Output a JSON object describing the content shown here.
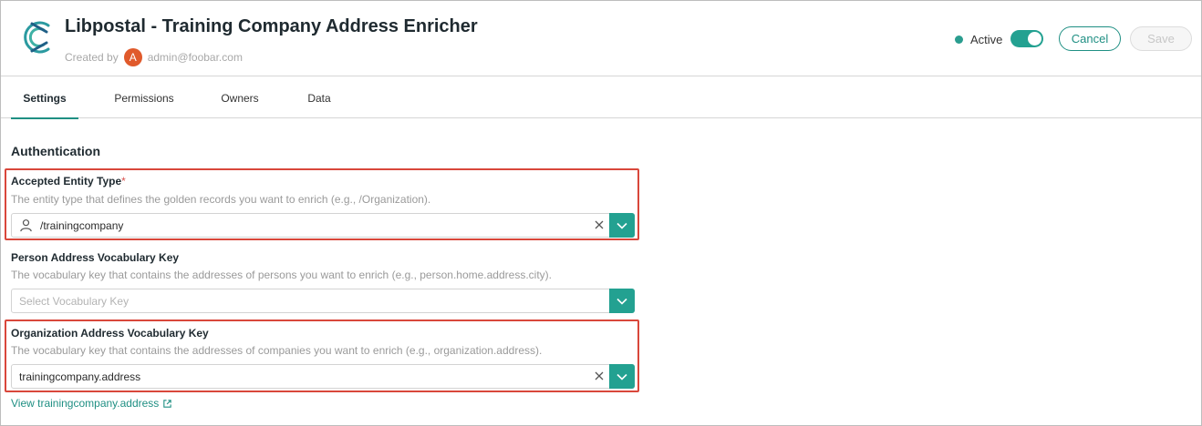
{
  "header": {
    "title": "Libpostal - Training Company Address Enricher",
    "created_by_label": "Created by",
    "avatar_initial": "A",
    "creator": "admin@foobar.com",
    "status_label": "Active",
    "toggle_on": true,
    "cancel_label": "Cancel",
    "save_label": "Save"
  },
  "tabs": [
    {
      "label": "Settings",
      "active": true
    },
    {
      "label": "Permissions",
      "active": false
    },
    {
      "label": "Owners",
      "active": false
    },
    {
      "label": "Data",
      "active": false
    }
  ],
  "form": {
    "section_title": "Authentication",
    "entity_type": {
      "label": "Accepted Entity Type",
      "required_mark": "*",
      "help": "The entity type that defines the golden records you want to enrich (e.g., /Organization).",
      "value": "/trainingcompany",
      "icon": "user-icon"
    },
    "person_key": {
      "label": "Person Address Vocabulary Key",
      "help": "The vocabulary key that contains the addresses of persons you want to enrich (e.g., person.home.address.city).",
      "placeholder": "Select Vocabulary Key"
    },
    "org_key": {
      "label": "Organization Address Vocabulary Key",
      "help": "The vocabulary key that contains the addresses of companies you want to enrich (e.g., organization.address).",
      "value": "trainingcompany.address"
    },
    "view_link": "View trainingcompany.address"
  },
  "colors": {
    "accent": "#23a191",
    "highlight": "#d9473b",
    "avatar": "#e05a2b",
    "required": "#d9534f"
  }
}
